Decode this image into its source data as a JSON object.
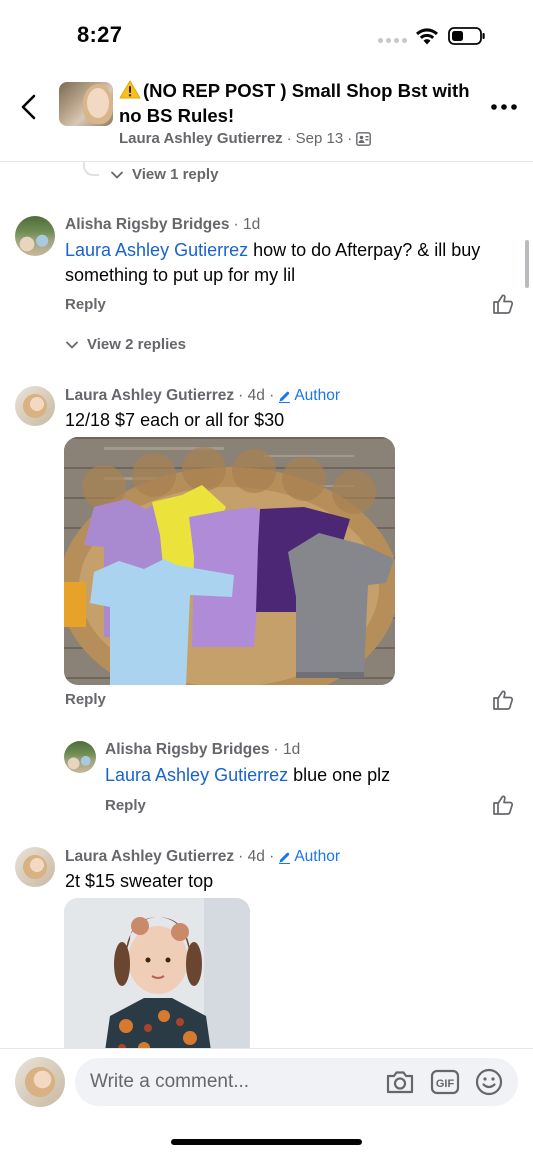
{
  "status": {
    "time": "8:27"
  },
  "header": {
    "title": "(NO REP POST ) Small Shop Bst with no BS Rules!",
    "author": "Laura Ashley Gutierrez",
    "date": "Sep 13",
    "separator": "·"
  },
  "thread": {
    "view_reply_top": "View 1 reply",
    "comments": [
      {
        "name": "Alisha Rigsby Bridges",
        "time": "1d",
        "mention": "Laura Ashley Gutierrez",
        "text": " how to do Afterpay? & ill buy something to put up for my lil",
        "reply": "Reply",
        "view_replies": "View 2 replies"
      },
      {
        "name": "Laura Ashley Gutierrez",
        "time": "4d",
        "author_badge": "Author",
        "text": "12/18 $7 each or all for $30",
        "reply": "Reply"
      },
      {
        "name": "Alisha Rigsby Bridges",
        "time": "1d",
        "mention": "Laura Ashley Gutierrez",
        "text": " blue one plz",
        "reply": "Reply"
      },
      {
        "name": "Laura Ashley Gutierrez",
        "time": "4d",
        "author_badge": "Author",
        "text": "2t $15 sweater top"
      }
    ]
  },
  "composer": {
    "placeholder": "Write a comment...",
    "icons": [
      "camera-icon",
      "gif-icon",
      "emoji-icon"
    ]
  },
  "colors": {
    "accent": "#1877f2",
    "mention": "#1763cf",
    "muted": "#65676b"
  }
}
